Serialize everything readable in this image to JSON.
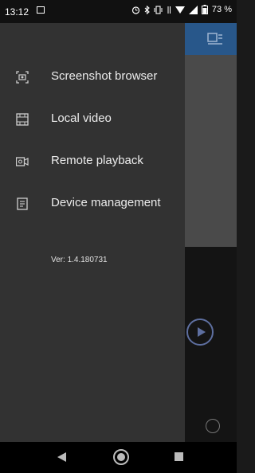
{
  "status_bar": {
    "time": "13:12",
    "icons": [
      "alarm-icon",
      "bluetooth-icon",
      "vibrate-icon",
      "data-arrows-icon",
      "wifi-icon",
      "signal-icon",
      "battery-icon"
    ],
    "battery": "73 %"
  },
  "drawer": {
    "items": [
      {
        "label": "Screenshot browser",
        "icon": "screenshot-icon"
      },
      {
        "label": "Local video",
        "icon": "film-icon"
      },
      {
        "label": "Remote playback",
        "icon": "camera-icon"
      },
      {
        "label": "Device management",
        "icon": "device-icon"
      }
    ],
    "version": "Ver:  1.4.180731"
  },
  "colors": {
    "drawer_bg": "#323232",
    "accent_bar": "#28578a",
    "text": "#ececec"
  }
}
